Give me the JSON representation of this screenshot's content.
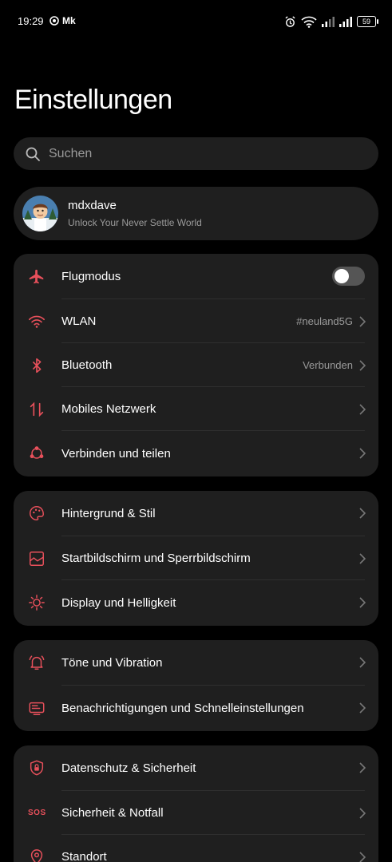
{
  "status_bar": {
    "time": "19:29",
    "carrier_badge": "Mk",
    "battery": "59",
    "icons": [
      "alarm-icon",
      "wifi-icon",
      "signal-icon",
      "signal-icon",
      "battery-icon"
    ]
  },
  "title": "Einstellungen",
  "search": {
    "placeholder": "Suchen"
  },
  "profile": {
    "name": "mdxdave",
    "subtitle": "Unlock Your Never Settle World"
  },
  "accent_color": "#e8505b",
  "groups": [
    {
      "items": [
        {
          "label": "Flugmodus",
          "icon": "airplane-icon",
          "toggle": false
        },
        {
          "label": "WLAN",
          "icon": "wifi-icon",
          "value": "#neuland5G"
        },
        {
          "label": "Bluetooth",
          "icon": "bluetooth-icon",
          "value": "Verbunden"
        },
        {
          "label": "Mobiles Netzwerk",
          "icon": "mobile-data-icon"
        },
        {
          "label": "Verbinden und teilen",
          "icon": "share-icon"
        }
      ]
    },
    {
      "items": [
        {
          "label": "Hintergrund & Stil",
          "icon": "palette-icon"
        },
        {
          "label": "Startbildschirm und Sperrbildschirm",
          "icon": "wallpaper-icon"
        },
        {
          "label": "Display und Helligkeit",
          "icon": "brightness-icon"
        }
      ]
    },
    {
      "items": [
        {
          "label": "Töne und Vibration",
          "icon": "bell-icon"
        },
        {
          "label": "Benachrichtigungen und Schnelleinstellungen",
          "icon": "notification-icon"
        }
      ]
    },
    {
      "items": [
        {
          "label": "Datenschutz & Sicherheit",
          "icon": "shield-lock-icon"
        },
        {
          "label": "Sicherheit & Notfall",
          "icon": "sos-icon",
          "icon_text": "SOS"
        },
        {
          "label": "Standort",
          "icon": "location-icon"
        }
      ]
    }
  ]
}
